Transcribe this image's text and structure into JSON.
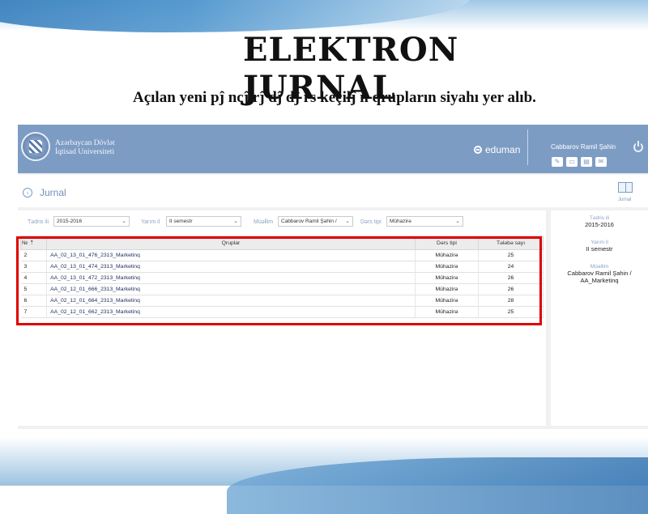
{
  "slide": {
    "title": "ELEKTRON JURNAL",
    "subtitle": "Açılan yeni pĵ ncĵ rĵ dĵ  dĵ rs keçilĵ n qrupların siyahı yer alıb."
  },
  "header": {
    "university_line1": "Azərbaycan Dövlət",
    "university_line2": "İqtisad Universiteti",
    "brand": "eduman",
    "user_name": "Cabbarov Ramil Şahin",
    "icons": [
      "edit-icon",
      "inbox-icon",
      "archive-icon",
      "message-icon",
      "power-icon"
    ]
  },
  "page": {
    "title": "Jurnal",
    "journal_button_label": "Jurnal"
  },
  "filters": {
    "year_label": "Tədris ili",
    "year_value": "2015-2016",
    "semester_label": "Yarım il",
    "semester_value": "II semestr",
    "teacher_label": "Müəllim",
    "teacher_value": "Cabbarov Ramil Şahin /",
    "lesson_type_label": "Dərs tipi",
    "lesson_type_value": "Mühazirə"
  },
  "table": {
    "headers": {
      "no": "№",
      "group": "Qruplar",
      "lesson_type": "Dərs tipi",
      "student_count": "Tələbə sayı"
    },
    "rows": [
      {
        "no": "2",
        "group": "AA_02_13_01_476_2313_Marketinq",
        "lesson_type": "Mühazirə",
        "student_count": "25"
      },
      {
        "no": "3",
        "group": "AA_02_13_01_474_2313_Marketinq",
        "lesson_type": "Mühazirə",
        "student_count": "24"
      },
      {
        "no": "4",
        "group": "AA_02_13_01_472_2313_Marketinq",
        "lesson_type": "Mühazirə",
        "student_count": "26"
      },
      {
        "no": "5",
        "group": "AA_02_12_01_666_2313_Marketinq",
        "lesson_type": "Mühazirə",
        "student_count": "26"
      },
      {
        "no": "6",
        "group": "AA_02_12_01_664_2313_Marketinq",
        "lesson_type": "Mühazirə",
        "student_count": "28"
      },
      {
        "no": "7",
        "group": "AA_02_12_01_662_2313_Marketinq",
        "lesson_type": "Mühazirə",
        "student_count": "25"
      }
    ]
  },
  "side_panel": {
    "year_label": "Tədris ili",
    "year_value": "2015-2016",
    "semester_label": "Yarım il",
    "semester_value": "II semestr",
    "teacher_label": "Müəllim",
    "teacher_value_line1": "Cabbarov Ramil Şahin /",
    "teacher_value_line2": "AA_Marketinq"
  },
  "colors": {
    "header_bg": "#7d9cc4",
    "highlight_frame": "#e00000",
    "label_blue": "#8aa3c6"
  }
}
